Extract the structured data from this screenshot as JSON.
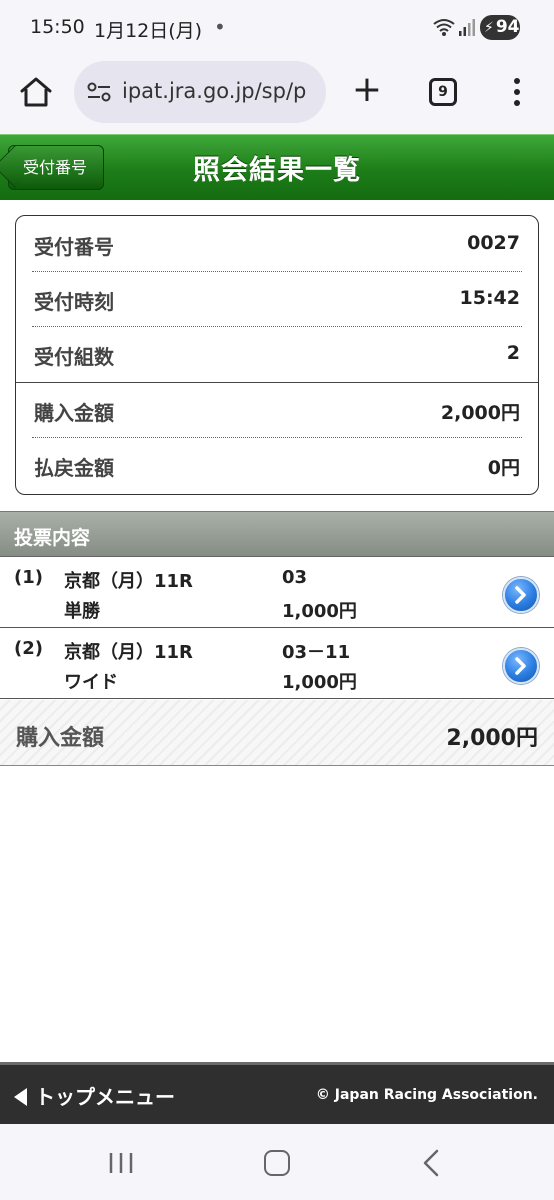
{
  "status_bar": {
    "time": "15:50",
    "date": "1月12日(月)",
    "dot": "•",
    "battery": "94"
  },
  "browser": {
    "url": "ipat.jra.go.jp/sp/p",
    "tab_count": "9"
  },
  "header": {
    "back_label": "受付番号",
    "title": "照会結果一覧"
  },
  "receipt": {
    "rows": [
      {
        "label": "受付番号",
        "value": "0027"
      },
      {
        "label": "受付時刻",
        "value": "15:42"
      },
      {
        "label": "受付組数",
        "value": "2"
      },
      {
        "label": "購入金額",
        "value": "2,000円"
      },
      {
        "label": "払戻金額",
        "value": "0円"
      }
    ]
  },
  "section": {
    "label": "投票内容"
  },
  "bets": [
    {
      "num": "(1)",
      "race": "京都（月）11R",
      "kind": "単勝",
      "combo": "03",
      "amount": "1,000円"
    },
    {
      "num": "(2)",
      "race": "京都（月）11R",
      "kind": "ワイド",
      "combo": "03－11",
      "amount": "1,000円"
    }
  ],
  "total": {
    "label": "購入金額",
    "value": "2,000円"
  },
  "footer": {
    "top_menu": "トップメニュー",
    "copyright": "© Japan Racing Association."
  }
}
